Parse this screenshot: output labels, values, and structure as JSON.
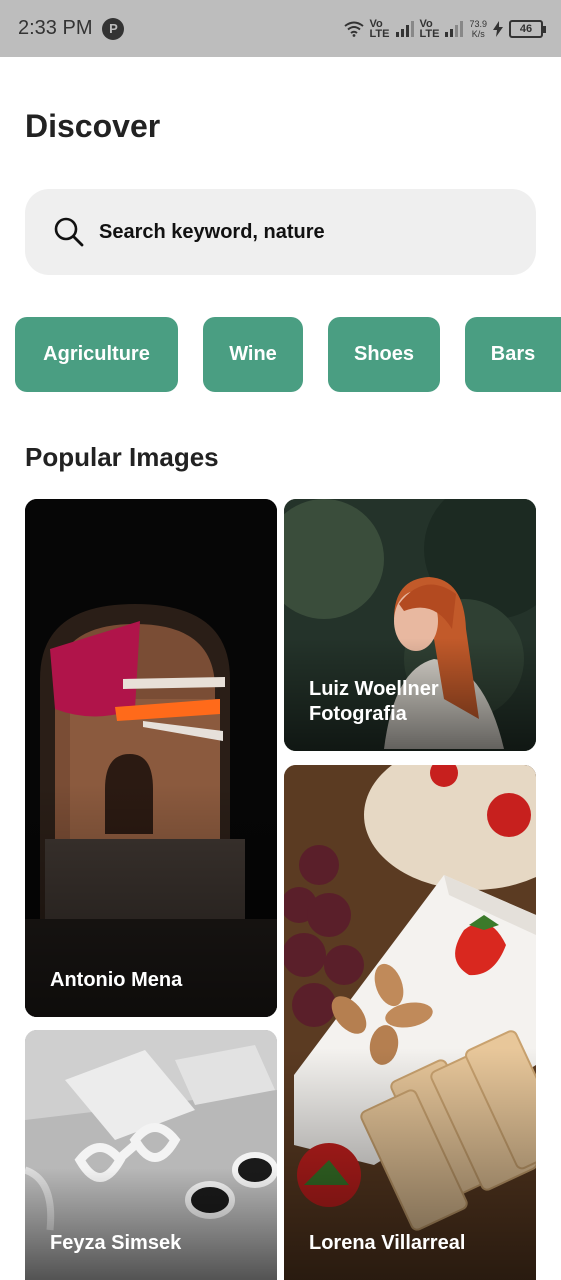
{
  "status_bar": {
    "time": "2:33 PM",
    "badge": "P",
    "net1_top": "Vo",
    "net1_bottom": "LTE",
    "net2_top": "Vo",
    "net2_bottom": "LTE",
    "speed_value": "73.9",
    "speed_unit": "K/s",
    "battery": "46"
  },
  "page": {
    "title": "Discover"
  },
  "search": {
    "placeholder": "Search keyword, nature"
  },
  "categories": [
    "Agriculture",
    "Wine",
    "Shoes",
    "Bars"
  ],
  "popular": {
    "title": "Popular Images",
    "items": [
      {
        "author": "Antonio Mena"
      },
      {
        "author": "Luiz Woellner Fotografia"
      },
      {
        "author": "Lorena Villarreal"
      },
      {
        "author": "Feyza Simsek"
      }
    ]
  },
  "colors": {
    "accent": "#4a9e82",
    "search_bg": "#efefef",
    "status_bg": "#bdbdbd"
  }
}
